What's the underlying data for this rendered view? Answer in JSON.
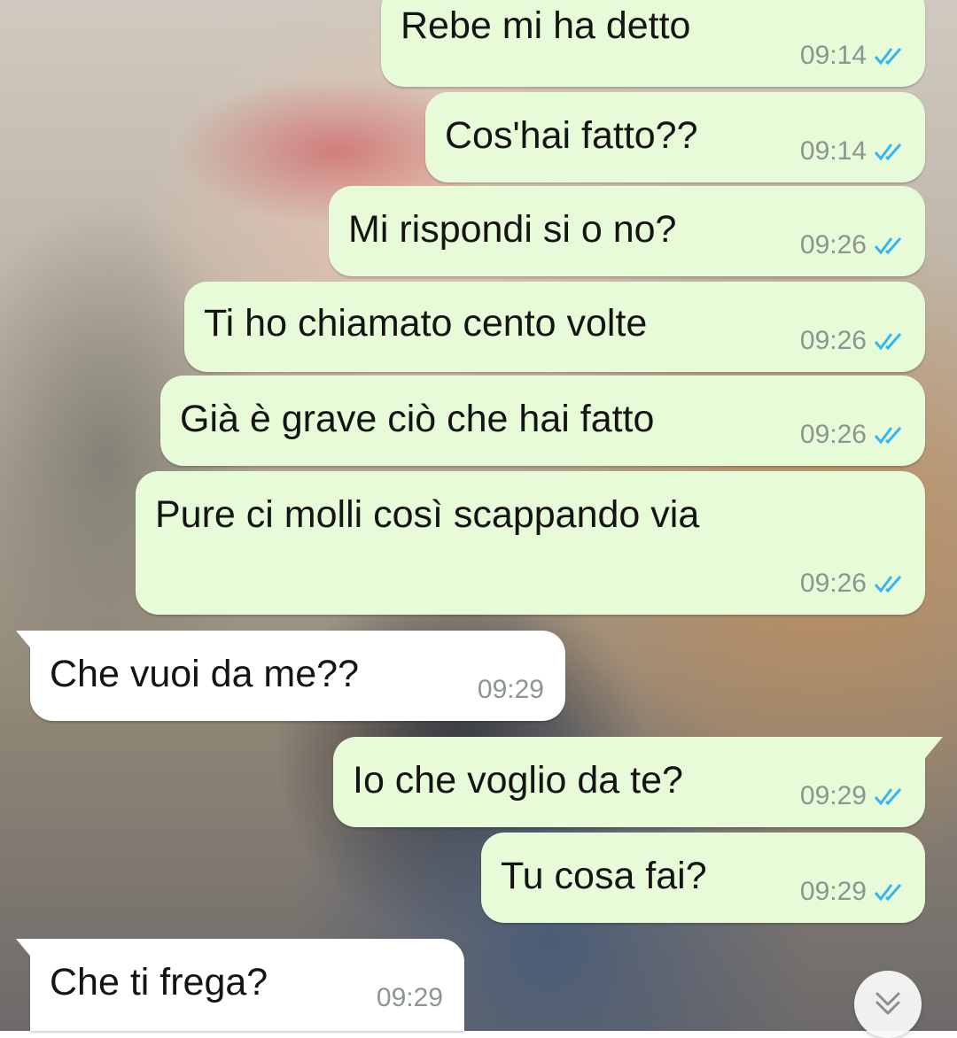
{
  "messages": [
    {
      "direction": "out",
      "text": "Rebe mi ha detto",
      "time": "09:14",
      "status": "read"
    },
    {
      "direction": "out",
      "text": "Cos'hai fatto??",
      "time": "09:14",
      "status": "read"
    },
    {
      "direction": "out",
      "text": "Mi rispondi si o no?",
      "time": "09:26",
      "status": "read"
    },
    {
      "direction": "out",
      "text": "Ti ho chiamato cento volte",
      "time": "09:26",
      "status": "read"
    },
    {
      "direction": "out",
      "text": "Già è grave ciò che hai fatto",
      "time": "09:26",
      "status": "read"
    },
    {
      "direction": "out",
      "text": "Pure ci molli così scappando via",
      "time": "09:26",
      "status": "read"
    },
    {
      "direction": "in",
      "text": "Che vuoi da me??",
      "time": "09:29"
    },
    {
      "direction": "out",
      "text": "Io che voglio da te?",
      "time": "09:29",
      "status": "read"
    },
    {
      "direction": "out",
      "text": "Tu cosa fai?",
      "time": "09:29",
      "status": "read"
    },
    {
      "direction": "in",
      "text": "Che ti frega?",
      "time": "09:29"
    }
  ],
  "colors": {
    "outgoing_bubble": "#e7fbd8",
    "incoming_bubble": "#ffffff",
    "read_ticks": "#34b7f1",
    "timestamp": "#8c9690"
  },
  "icons": {
    "read_status": "double-check-icon",
    "scroll_down": "chevron-double-down-icon"
  }
}
